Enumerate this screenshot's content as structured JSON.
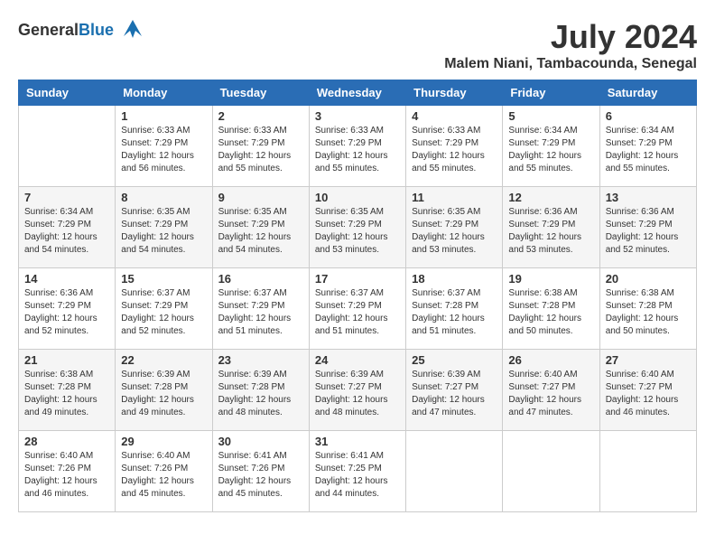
{
  "header": {
    "logo_general": "General",
    "logo_blue": "Blue",
    "month_year": "July 2024",
    "location": "Malem Niani, Tambacounda, Senegal"
  },
  "calendar": {
    "days_of_week": [
      "Sunday",
      "Monday",
      "Tuesday",
      "Wednesday",
      "Thursday",
      "Friday",
      "Saturday"
    ],
    "weeks": [
      [
        {
          "day": "",
          "info": ""
        },
        {
          "day": "1",
          "info": "Sunrise: 6:33 AM\nSunset: 7:29 PM\nDaylight: 12 hours\nand 56 minutes."
        },
        {
          "day": "2",
          "info": "Sunrise: 6:33 AM\nSunset: 7:29 PM\nDaylight: 12 hours\nand 55 minutes."
        },
        {
          "day": "3",
          "info": "Sunrise: 6:33 AM\nSunset: 7:29 PM\nDaylight: 12 hours\nand 55 minutes."
        },
        {
          "day": "4",
          "info": "Sunrise: 6:33 AM\nSunset: 7:29 PM\nDaylight: 12 hours\nand 55 minutes."
        },
        {
          "day": "5",
          "info": "Sunrise: 6:34 AM\nSunset: 7:29 PM\nDaylight: 12 hours\nand 55 minutes."
        },
        {
          "day": "6",
          "info": "Sunrise: 6:34 AM\nSunset: 7:29 PM\nDaylight: 12 hours\nand 55 minutes."
        }
      ],
      [
        {
          "day": "7",
          "info": "Sunrise: 6:34 AM\nSunset: 7:29 PM\nDaylight: 12 hours\nand 54 minutes."
        },
        {
          "day": "8",
          "info": "Sunrise: 6:35 AM\nSunset: 7:29 PM\nDaylight: 12 hours\nand 54 minutes."
        },
        {
          "day": "9",
          "info": "Sunrise: 6:35 AM\nSunset: 7:29 PM\nDaylight: 12 hours\nand 54 minutes."
        },
        {
          "day": "10",
          "info": "Sunrise: 6:35 AM\nSunset: 7:29 PM\nDaylight: 12 hours\nand 53 minutes."
        },
        {
          "day": "11",
          "info": "Sunrise: 6:35 AM\nSunset: 7:29 PM\nDaylight: 12 hours\nand 53 minutes."
        },
        {
          "day": "12",
          "info": "Sunrise: 6:36 AM\nSunset: 7:29 PM\nDaylight: 12 hours\nand 53 minutes."
        },
        {
          "day": "13",
          "info": "Sunrise: 6:36 AM\nSunset: 7:29 PM\nDaylight: 12 hours\nand 52 minutes."
        }
      ],
      [
        {
          "day": "14",
          "info": "Sunrise: 6:36 AM\nSunset: 7:29 PM\nDaylight: 12 hours\nand 52 minutes."
        },
        {
          "day": "15",
          "info": "Sunrise: 6:37 AM\nSunset: 7:29 PM\nDaylight: 12 hours\nand 52 minutes."
        },
        {
          "day": "16",
          "info": "Sunrise: 6:37 AM\nSunset: 7:29 PM\nDaylight: 12 hours\nand 51 minutes."
        },
        {
          "day": "17",
          "info": "Sunrise: 6:37 AM\nSunset: 7:29 PM\nDaylight: 12 hours\nand 51 minutes."
        },
        {
          "day": "18",
          "info": "Sunrise: 6:37 AM\nSunset: 7:28 PM\nDaylight: 12 hours\nand 51 minutes."
        },
        {
          "day": "19",
          "info": "Sunrise: 6:38 AM\nSunset: 7:28 PM\nDaylight: 12 hours\nand 50 minutes."
        },
        {
          "day": "20",
          "info": "Sunrise: 6:38 AM\nSunset: 7:28 PM\nDaylight: 12 hours\nand 50 minutes."
        }
      ],
      [
        {
          "day": "21",
          "info": "Sunrise: 6:38 AM\nSunset: 7:28 PM\nDaylight: 12 hours\nand 49 minutes."
        },
        {
          "day": "22",
          "info": "Sunrise: 6:39 AM\nSunset: 7:28 PM\nDaylight: 12 hours\nand 49 minutes."
        },
        {
          "day": "23",
          "info": "Sunrise: 6:39 AM\nSunset: 7:28 PM\nDaylight: 12 hours\nand 48 minutes."
        },
        {
          "day": "24",
          "info": "Sunrise: 6:39 AM\nSunset: 7:27 PM\nDaylight: 12 hours\nand 48 minutes."
        },
        {
          "day": "25",
          "info": "Sunrise: 6:39 AM\nSunset: 7:27 PM\nDaylight: 12 hours\nand 47 minutes."
        },
        {
          "day": "26",
          "info": "Sunrise: 6:40 AM\nSunset: 7:27 PM\nDaylight: 12 hours\nand 47 minutes."
        },
        {
          "day": "27",
          "info": "Sunrise: 6:40 AM\nSunset: 7:27 PM\nDaylight: 12 hours\nand 46 minutes."
        }
      ],
      [
        {
          "day": "28",
          "info": "Sunrise: 6:40 AM\nSunset: 7:26 PM\nDaylight: 12 hours\nand 46 minutes."
        },
        {
          "day": "29",
          "info": "Sunrise: 6:40 AM\nSunset: 7:26 PM\nDaylight: 12 hours\nand 45 minutes."
        },
        {
          "day": "30",
          "info": "Sunrise: 6:41 AM\nSunset: 7:26 PM\nDaylight: 12 hours\nand 45 minutes."
        },
        {
          "day": "31",
          "info": "Sunrise: 6:41 AM\nSunset: 7:25 PM\nDaylight: 12 hours\nand 44 minutes."
        },
        {
          "day": "",
          "info": ""
        },
        {
          "day": "",
          "info": ""
        },
        {
          "day": "",
          "info": ""
        }
      ]
    ]
  }
}
